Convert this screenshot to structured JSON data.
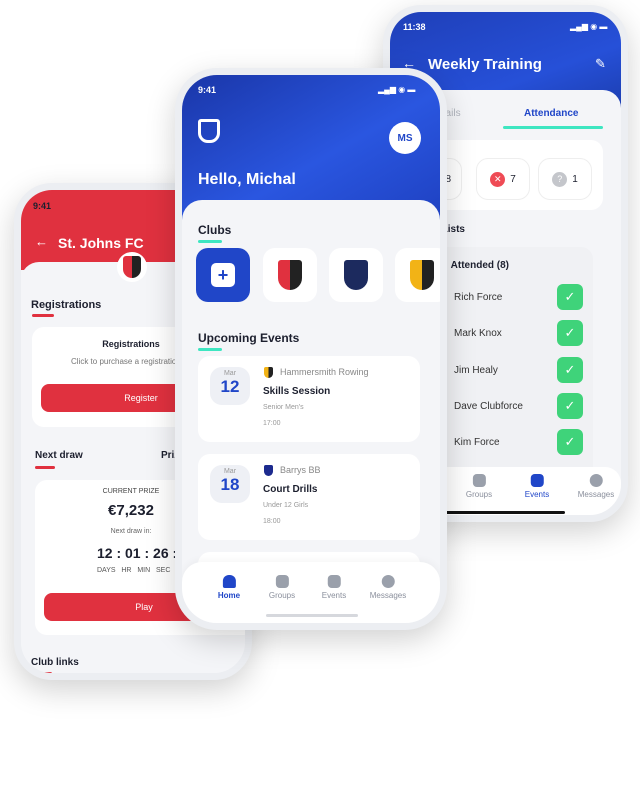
{
  "right_phone": {
    "time": "11:38",
    "title": "Weekly Training",
    "tabs": [
      "Details",
      "Attendance"
    ],
    "stats": [
      {
        "icon": "check-icon",
        "value": "8"
      },
      {
        "icon": "x-icon",
        "value": "7"
      },
      {
        "icon": "question-icon",
        "value": "1"
      }
    ],
    "section": "Lists",
    "group": "Attended (8)",
    "people": [
      "Rich Force",
      "Mark Knox",
      "Jim Healy",
      "Dave Clubforce",
      "Kim Force"
    ],
    "nav": [
      "Groups",
      "Events",
      "Messages"
    ]
  },
  "left_phone": {
    "time": "9:41",
    "title": "St. Johns FC",
    "registrations_heading": "Registrations",
    "card_title": "Registrations",
    "card_text": "Click to purchase a registration",
    "register_label": "Register",
    "next_draw": "Next draw",
    "prizes_tab": "Prizes",
    "current_prize_label": "CURRENT PRIZE",
    "current_prize": "€7,232",
    "next_draw_in": "Next draw in:",
    "countdown": "12 : 01 : 26 :51",
    "countdown_units": "DAYS   HR   MIN   SEC",
    "play_label": "Play",
    "club_links": "Club links"
  },
  "middle_phone": {
    "time": "9:41",
    "avatar": "MS",
    "greeting": "Hello, Michal",
    "clubs_heading": "Clubs",
    "events_heading": "Upcoming Events",
    "events": [
      {
        "month": "Mar",
        "day": "12",
        "club": "Hammersmith Rowing",
        "title": "Skills Session",
        "group": "Senior Men's",
        "time": "17:00"
      },
      {
        "month": "Mar",
        "day": "18",
        "club": "Barrys BB",
        "title": "Court Drills",
        "group": "Under 12 Girls",
        "time": "18:00"
      }
    ],
    "nav": [
      "Home",
      "Groups",
      "Events",
      "Messages"
    ],
    "active_nav": "Home"
  },
  "colors": {
    "blue": "#1f44c4",
    "red": "#e0313f",
    "teal": "#3ee6c1",
    "green": "#3fd37a"
  }
}
